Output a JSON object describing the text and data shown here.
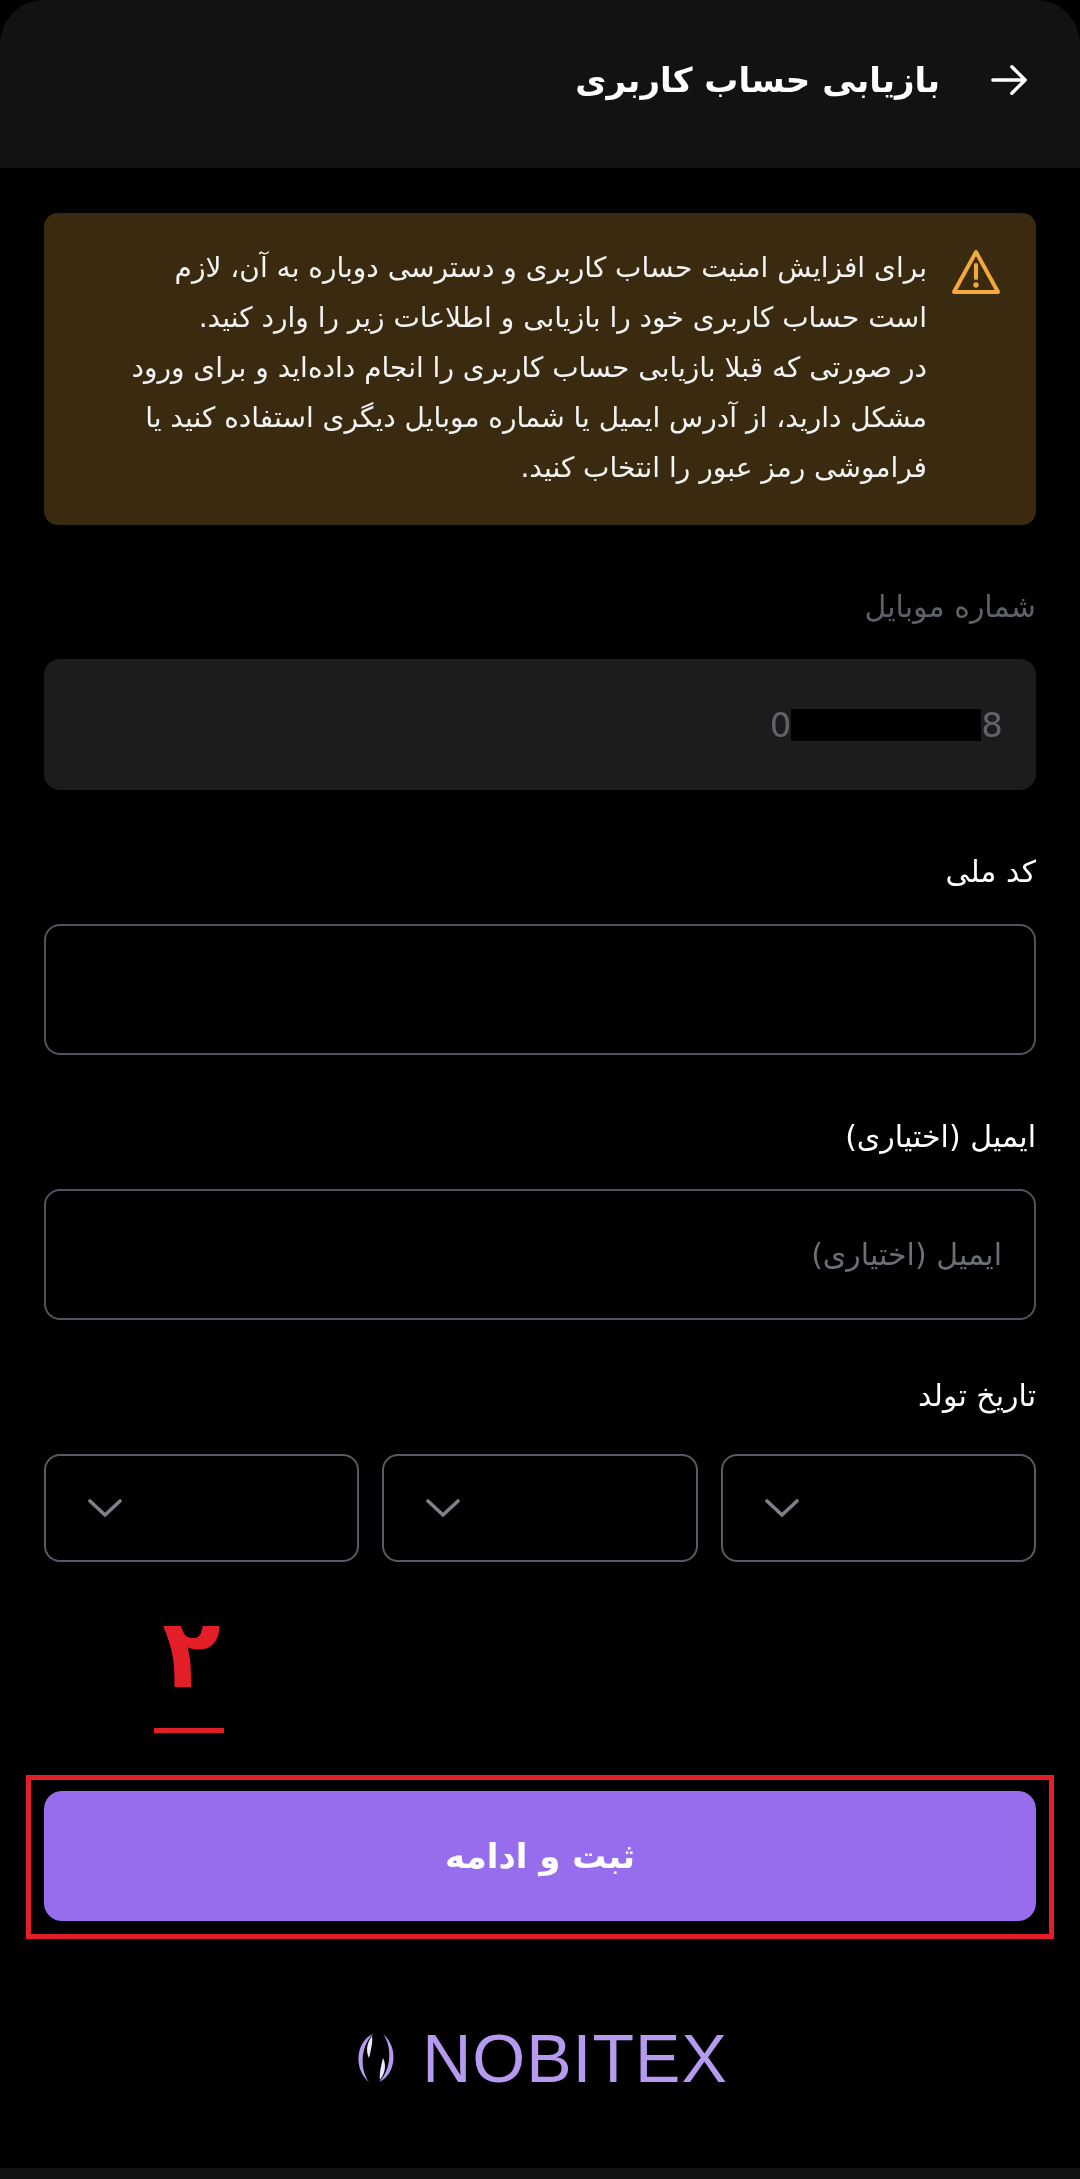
{
  "header": {
    "title": "بازیابی حساب کاربری"
  },
  "notice": {
    "kind": "warning",
    "paragraphs": [
      "برای افزایش امنیت حساب کاربری و دسترسی دوباره به آن، لازم است حساب کاربری خود را بازیابی و اطلاعات زیر را وارد کنید.",
      "در صورتی که قبلا بازیابی حساب کاربری را انجام داده‌اید و برای ورود مشکل دارید، از آدرس ایمیل یا شماره موبایل دیگری استفاده کنید یا فراموشی رمز عبور را انتخاب کنید."
    ]
  },
  "fields": [
    {
      "kind": "text",
      "label": "شماره موبایل",
      "disabled": true,
      "value_start": "0",
      "value_end": "8",
      "redacted": true
    },
    {
      "kind": "text",
      "label": "کد ملی",
      "disabled": false
    },
    {
      "kind": "text",
      "label": "ایمیل (اختیاری)",
      "disabled": false,
      "placeholder": "ایمیل (اختیاری)"
    },
    {
      "kind": "date",
      "label": "تاریخ تولد",
      "selects": [
        {
          "expanded": false
        },
        {
          "expanded": false
        },
        {
          "expanded": false
        }
      ]
    }
  ],
  "annotation": {
    "number": "۲"
  },
  "submit_button": {
    "label": "ثبت و ادامه",
    "highlighted": true
  },
  "logo": {
    "wordmark": "NOBITEX"
  }
}
